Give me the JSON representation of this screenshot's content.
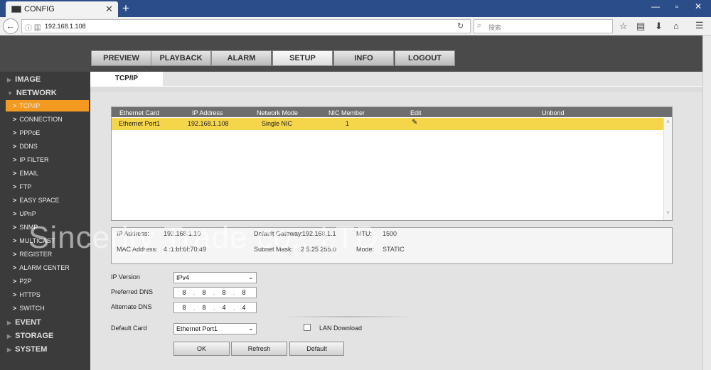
{
  "browser": {
    "tab_title": "CONFIG",
    "url": "192.168.1.108",
    "search_placeholder": "搜索"
  },
  "main_tabs": [
    "PREVIEW",
    "PLAYBACK",
    "ALARM",
    "SETUP",
    "INFO",
    "LOGOUT"
  ],
  "active_main_tab": "SETUP",
  "sidebar": {
    "sections_top": [
      "IMAGE",
      "NETWORK"
    ],
    "network_items": [
      "TCP/IP",
      "CONNECTION",
      "PPPoE",
      "DDNS",
      "IP FILTER",
      "EMAIL",
      "FTP",
      "EASY SPACE",
      "UPnP",
      "SNMP",
      "MULTICAST",
      "REGISTER",
      "ALARM CENTER",
      "P2P",
      "HTTPS",
      "SWITCH"
    ],
    "active_item": "TCP/IP",
    "sections_bottom": [
      "EVENT",
      "STORAGE",
      "SYSTEM"
    ]
  },
  "content_tab": "TCP/IP",
  "table": {
    "headers": [
      "Ethernet Card",
      "IP Address",
      "Network Mode",
      "NIC Member",
      "Edit",
      "Unbond"
    ],
    "row": [
      "Ethernet Port1",
      "192.168.1.108",
      "Single NIC",
      "1"
    ]
  },
  "info": {
    "ip_label": "IP Address:",
    "ip_value": "192.168.1.10",
    "gateway_label": "Default Gateway:",
    "gateway_value": "192.168.1.1",
    "mtu_label": "MTU:",
    "mtu_value": "1500",
    "mac_label": "MAC Address:",
    "mac_value": "4 :1:bf:6f:70:49",
    "mask_label": "Subnet Mask:",
    "mask_value": "2 5.25 255.0",
    "mode_label": "Mode:",
    "mode_value": "STATIC"
  },
  "form": {
    "ip_version_label": "IP Version",
    "ip_version_value": "IPv4",
    "preferred_dns_label": "Preferred DNS",
    "preferred_dns": [
      "8",
      "8",
      "8",
      "8"
    ],
    "alternate_dns_label": "Alternate DNS",
    "alternate_dns": [
      "8",
      "8",
      "4",
      "4"
    ],
    "default_card_label": "Default Card",
    "default_card_value": "Ethernet Port1",
    "lan_download_label": "LAN Download"
  },
  "buttons": {
    "ok": "OK",
    "refresh": "Refresh",
    "default": "Default"
  },
  "watermark": "Sincerity Trade co., LTD"
}
